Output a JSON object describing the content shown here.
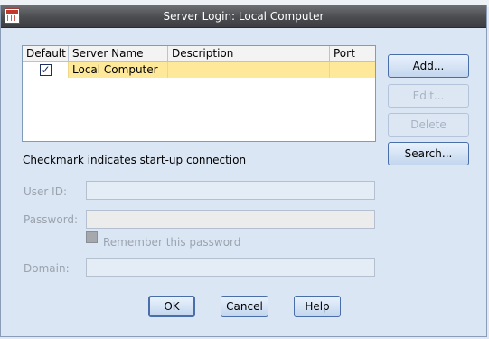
{
  "window": {
    "title": "Server Login: Local Computer"
  },
  "table": {
    "columns": [
      "Default",
      "Server Name",
      "Description",
      "Port"
    ],
    "rows": [
      {
        "default_checked": true,
        "checkmark": "✓",
        "server_name": "Local Computer",
        "description": "",
        "port": ""
      }
    ]
  },
  "buttons": {
    "add": "Add...",
    "edit": "Edit...",
    "delete": "Delete",
    "search": "Search..."
  },
  "note": "Checkmark indicates start-up connection",
  "form": {
    "user_id_label": "User ID:",
    "user_id_value": "",
    "password_label": "Password:",
    "password_value": "",
    "remember_label": "Remember this password",
    "remember_checked": false,
    "domain_label": "Domain:",
    "domain_value": ""
  },
  "footer": {
    "ok": "OK",
    "cancel": "Cancel",
    "help": "Help"
  }
}
